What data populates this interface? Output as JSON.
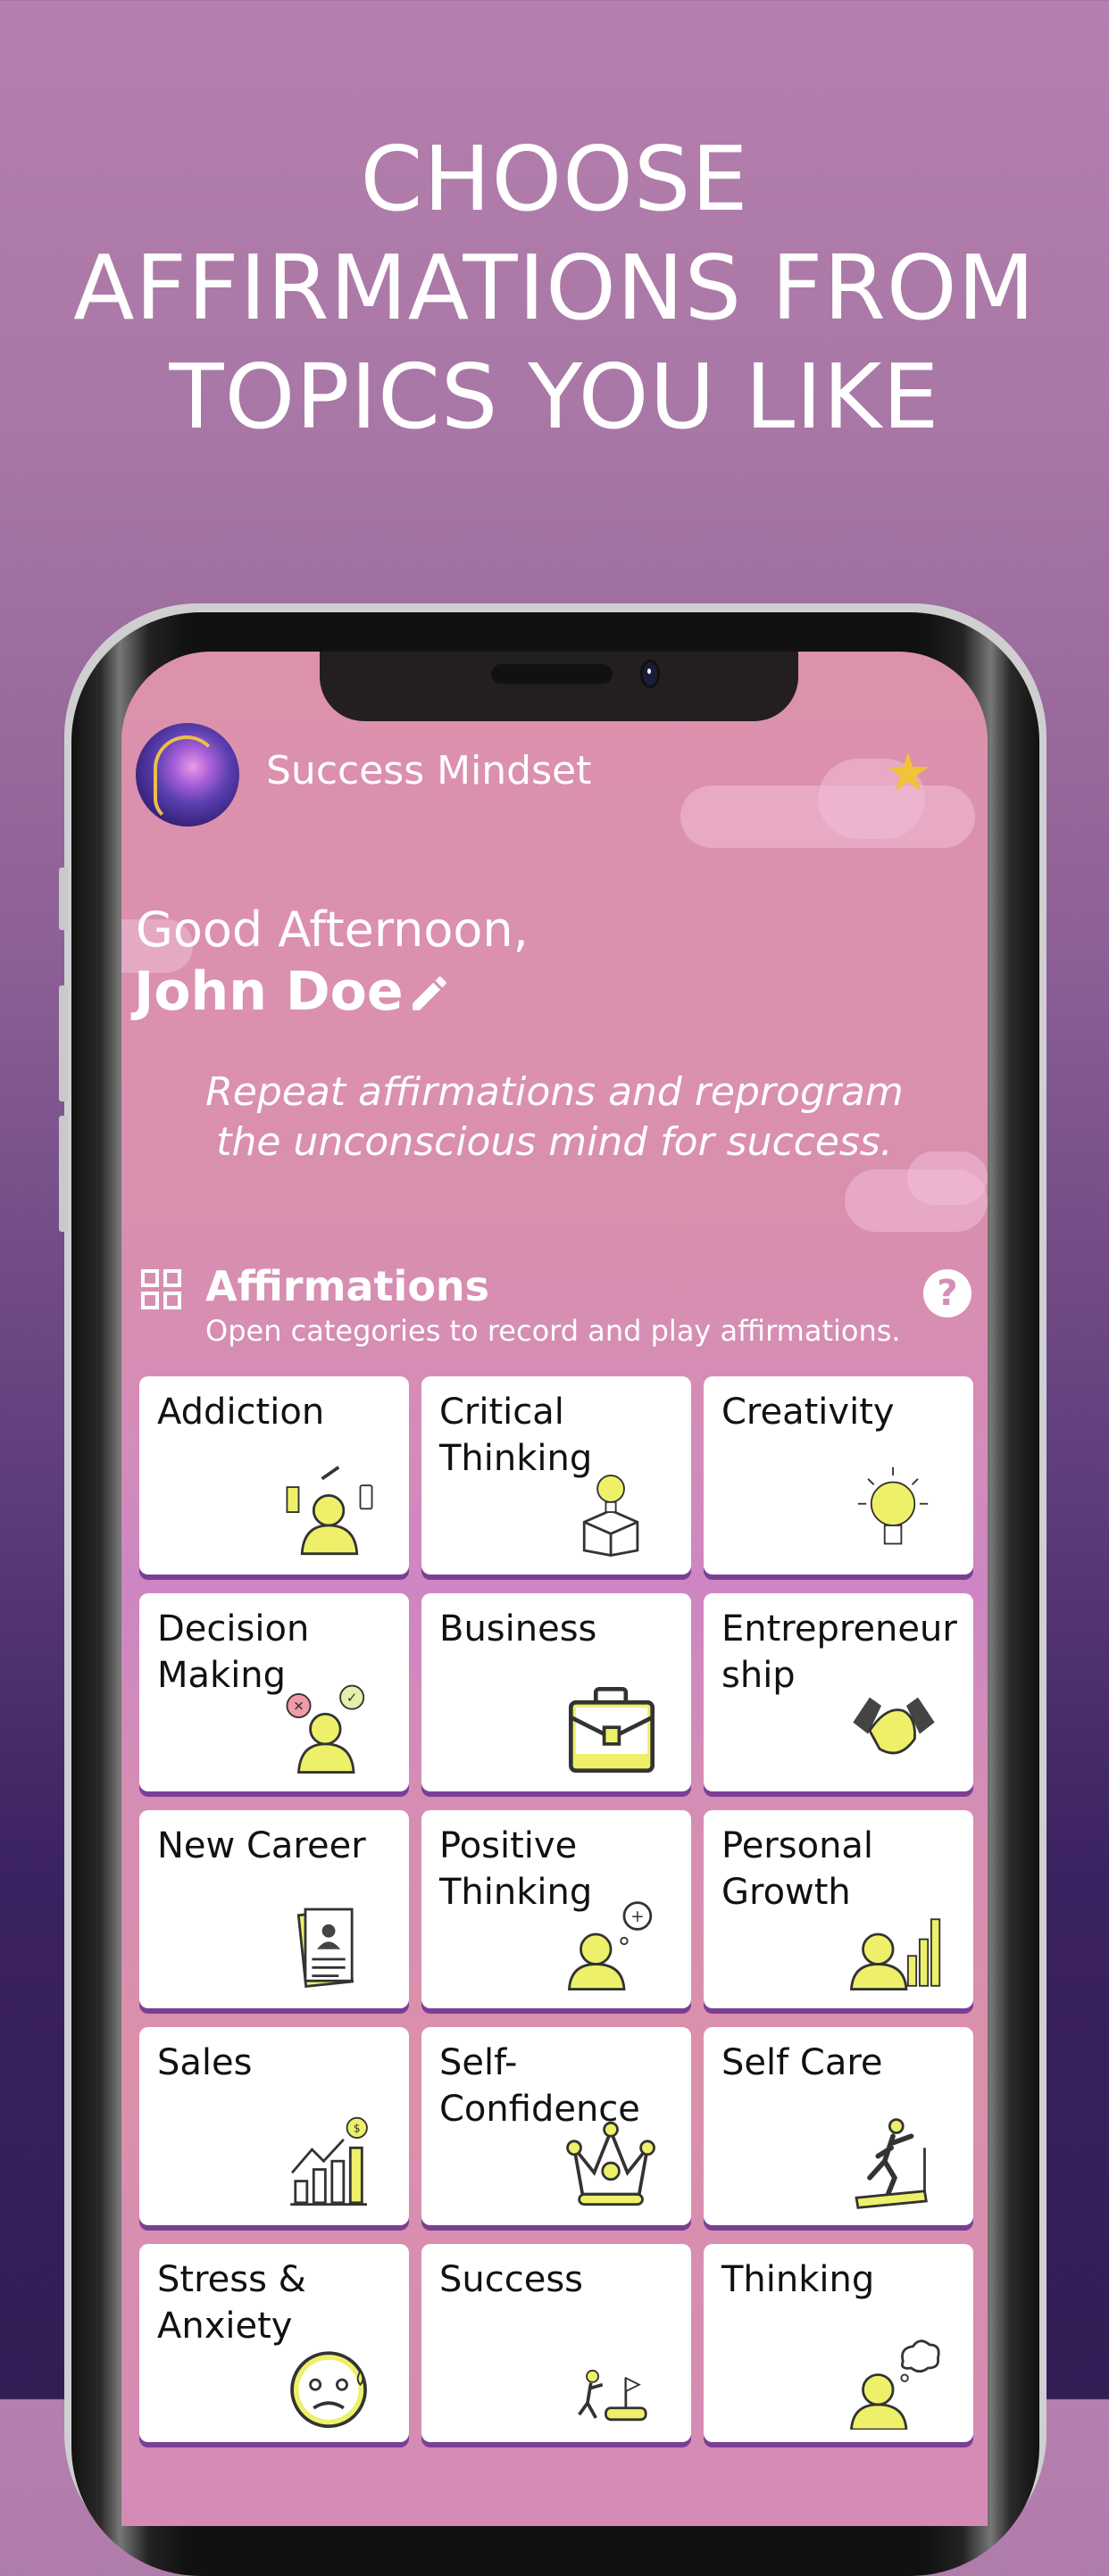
{
  "headline": {
    "lines": [
      "CHOOSE",
      "AFFIRMATIONS FROM",
      "TOPICS YOU LIKE"
    ]
  },
  "app": {
    "name": "Success Mindset",
    "logo_icon": "brain-head-logo",
    "favorite_icon": "star-icon",
    "star_glyph": "★"
  },
  "greeting": {
    "salutation": "Good Afternoon,",
    "user_name": "John Doe",
    "edit_icon": "pencil-icon"
  },
  "tagline": {
    "line1": "Repeat affirmations and reprogram",
    "line2": "the unconscious mind for success."
  },
  "section": {
    "title": "Affirmations",
    "subtitle": "Open categories to record and play affirmations.",
    "help_label": "?",
    "icon": "grid-icon"
  },
  "colors": {
    "accent_yellow": "#eef06a",
    "star": "#f3c13a",
    "card_shadow": "#7a3f95",
    "screen_pink": "#dc91ad"
  },
  "categories": [
    {
      "label": "Addiction",
      "icon": "addicted-person-icon"
    },
    {
      "label": "Critical\nThinking",
      "icon": "lightbulb-box-icon"
    },
    {
      "label": "Creativity",
      "icon": "lightbulb-icon"
    },
    {
      "label": "Decision\nMaking",
      "icon": "person-choice-icon"
    },
    {
      "label": "Business",
      "icon": "briefcase-icon"
    },
    {
      "label": "Entrepreneur\nship",
      "icon": "handshake-icon"
    },
    {
      "label": "New Career",
      "icon": "resume-icon"
    },
    {
      "label": "Positive\nThinking",
      "icon": "person-thought-plus-icon"
    },
    {
      "label": "Personal\nGrowth",
      "icon": "person-growth-chart-icon"
    },
    {
      "label": "Sales",
      "icon": "sales-chart-icon"
    },
    {
      "label": "Self-\nConfidence",
      "icon": "crown-icon"
    },
    {
      "label": "Self Care",
      "icon": "treadmill-runner-icon"
    },
    {
      "label": "Stress &\nAnxiety",
      "icon": "anxious-face-icon"
    },
    {
      "label": "Success",
      "icon": "climb-flag-icon"
    },
    {
      "label": "Thinking",
      "icon": "person-thought-icon"
    }
  ]
}
